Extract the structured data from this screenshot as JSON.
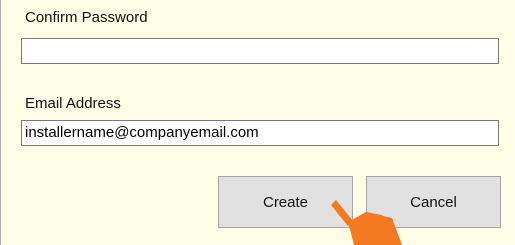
{
  "form": {
    "confirm_password": {
      "label": "Confirm Password",
      "value": ""
    },
    "email": {
      "label": "Email Address",
      "value": "installername@companyemail.com"
    }
  },
  "actions": {
    "create_label": "Create",
    "cancel_label": "Cancel"
  },
  "colors": {
    "panel_background": "#fefee6",
    "button_background": "#e1e1e1",
    "pointer": "#f47920"
  },
  "icons": {
    "pointer": "hand-pointer-icon"
  }
}
